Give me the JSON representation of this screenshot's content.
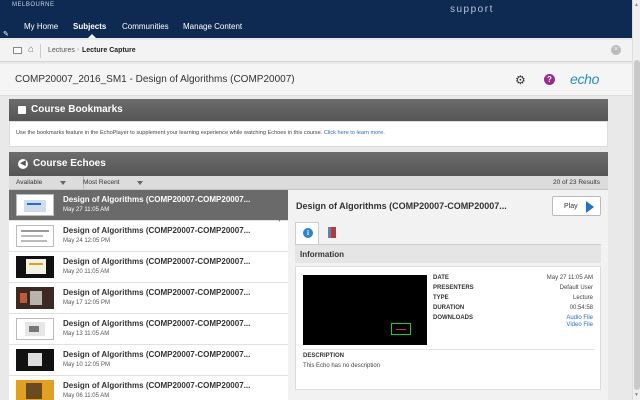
{
  "header": {
    "brand": "MELBOURNE",
    "support": "support",
    "nav": [
      {
        "label": "My Home"
      },
      {
        "label": "Subjects"
      },
      {
        "label": "Communities"
      },
      {
        "label": "Manage Content"
      }
    ]
  },
  "breadcrumb": {
    "items": [
      "Lectures",
      "Lecture Capture"
    ]
  },
  "page": {
    "title": "COMP20007_2016_SM1 - Design of Algorithms (COMP20007)",
    "logo": "echo"
  },
  "bookmarks": {
    "title": "Course Bookmarks",
    "text": "Use the bookmarks feature in the EchoPlayer to supplement your learning experience while watching Echoes in this course.",
    "link": "Click here to learn more."
  },
  "echoes": {
    "title": "Course Echoes",
    "filter1": "Available",
    "filter2": "Most Recent",
    "result_count": "20 of 23 Results",
    "items": [
      {
        "title": "Design of Algorithms (COMP20007-COMP20007...",
        "date": "May 27 11:05 AM"
      },
      {
        "title": "Design of Algorithms (COMP20007-COMP20007...",
        "date": "May 24 12:05 PM"
      },
      {
        "title": "Design of Algorithms (COMP20007-COMP20007...",
        "date": "May 20 11:05 AM"
      },
      {
        "title": "Design of Algorithms (COMP20007-COMP20007...",
        "date": "May 17 12:05 PM"
      },
      {
        "title": "Design of Algorithms (COMP20007-COMP20007...",
        "date": "May 13 11:05 AM"
      },
      {
        "title": "Design of Algorithms (COMP20007-COMP20007...",
        "date": "May 10 12:05 PM"
      },
      {
        "title": "Design of Algorithms (COMP20007-COMP20007...",
        "date": "May 06 11:05 AM"
      }
    ]
  },
  "detail": {
    "title": "Design of Algorithms (COMP20007-COMP20007...",
    "play_label": "Play",
    "info_label": "Information",
    "meta": {
      "date_key": "DATE",
      "date_val": "May 27 11:05 AM",
      "presenters_key": "PRESENTERS",
      "presenters_val": "Default User",
      "type_key": "TYPE",
      "type_val": "Lecture",
      "duration_key": "DURATION",
      "duration_val": "00:54:58",
      "downloads_key": "DOWNLOADS",
      "audio_file": "Audio File",
      "video_file": "Video File"
    },
    "description_key": "DESCRIPTION",
    "description_val": "This Echo has no description"
  }
}
